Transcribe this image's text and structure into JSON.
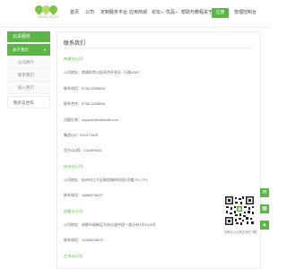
{
  "header": {
    "logo_text": "SMARTSOFT",
    "nav": [
      {
        "label": "首页",
        "chev": false
      },
      {
        "label": "公司",
        "chev": false
      },
      {
        "label": "定制服务平台",
        "chev": false
      },
      {
        "label": "应用商城",
        "chev": false
      },
      {
        "label": "论坛",
        "chev": true
      },
      {
        "label": "优品",
        "chev": true
      },
      {
        "label": "帮助与教程",
        "chev": true
      },
      {
        "label": "关于",
        "chev": true
      },
      {
        "label": "下载",
        "chev": false
      }
    ],
    "register_label": "注册",
    "admin_label": "管理控制台"
  },
  "sidebar": {
    "head": "云采服务",
    "group": "关于我们",
    "subitems": [
      "公司简介",
      "联系我们",
      "加入我们"
    ],
    "plain": "购买与合作"
  },
  "content": {
    "title": "联系我们",
    "lines": [
      {
        "text": "南通分公司",
        "head": true
      },
      {
        "text": "公司地址：南通市崇川区经济开发区...行路4287",
        "head": false
      },
      {
        "text": "联系电话：0756-3335865",
        "head": false
      },
      {
        "text": "联系合作：0756-3335865",
        "head": false
      },
      {
        "text": "问题反馈：support@falsesoft.com",
        "head": false
      },
      {
        "text": "集团QQ：622271629",
        "head": false
      },
      {
        "text": "官方QQ群：216299526",
        "head": false
      },
      {
        "text": "杭州分公司",
        "head": true
      },
      {
        "text": "公司地址：杭州市江干区新加城科技园1号楼7F1-7F3",
        "head": false
      },
      {
        "text": "联系电话：18868736227",
        "head": false
      },
      {
        "text": "成都分公司",
        "head": true
      },
      {
        "text": "公司地址：成都市高新区天府大道中段一类天府1号1105号",
        "head": false
      },
      {
        "text": "联系电话：15308236072",
        "head": false
      },
      {
        "text": "兰州分公司",
        "head": true
      }
    ]
  },
  "qr": {
    "caption": "扫码加入云采交流学习群"
  },
  "float_bar": {
    "icons": [
      "chat-icon",
      "qrcode-icon",
      "top-icon"
    ]
  },
  "colors": {
    "accent": "#5bb647",
    "border": "#eeeeee"
  }
}
